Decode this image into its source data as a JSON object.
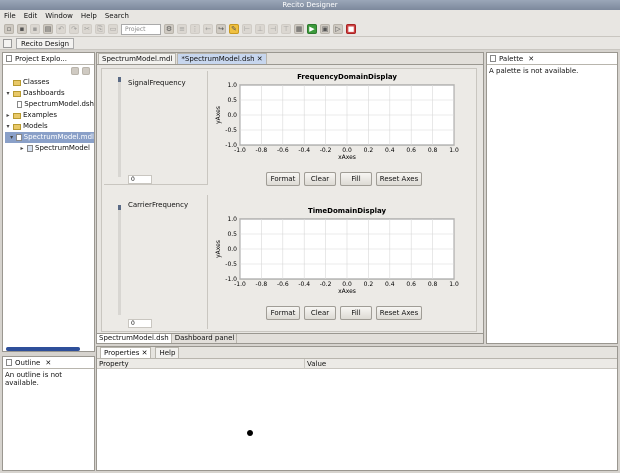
{
  "window": {
    "title": "Recito Designer"
  },
  "menu": [
    "File",
    "Edit",
    "Window",
    "Help",
    "Search"
  ],
  "toolbar": {
    "project_combo": "Project"
  },
  "perspective": {
    "label": "Recito Design"
  },
  "project_explorer": {
    "title": "Project Explo...",
    "items": [
      "Classes",
      "Dashboards",
      "SpectrumModel.dsh",
      "Examples",
      "Models",
      "SpectrumModel.mdl",
      "SpectrumModel"
    ]
  },
  "editor": {
    "tabs": [
      "SpectrumModel.mdl",
      "*SpectrumModel.dsh"
    ],
    "bottom_tabs": [
      "SpectrumModel.dsh",
      "Dashboard panel"
    ]
  },
  "dashboard": [
    {
      "slider_label": "SignalFrequency",
      "slider_value": "0",
      "slider_level": 0.05
    },
    {
      "slider_label": "CarrierFrequency",
      "slider_value": "0",
      "slider_level": 0.05
    }
  ],
  "buttons": [
    "Format",
    "Clear",
    "Fill",
    "Reset Axes"
  ],
  "palette": {
    "title": "Palette",
    "message": "A palette is not available."
  },
  "outline": {
    "title": "Outline",
    "message": "An outline is not available."
  },
  "properties": {
    "tabs": [
      "Properties",
      "Help"
    ],
    "columns": [
      "Property",
      "Value"
    ]
  },
  "chart_data": [
    {
      "type": "line",
      "title": "FrequencyDomainDisplay",
      "xlabel": "xAxes",
      "ylabel": "yAxes",
      "xlim": [
        -1.0,
        1.0
      ],
      "ylim": [
        -1.0,
        1.0
      ],
      "xticks": [
        "-1.0",
        "-0.8",
        "-0.6",
        "-0.4",
        "-0.2",
        "0.0",
        "0.2",
        "0.4",
        "0.6",
        "0.8",
        "1.0"
      ],
      "yticks": [
        "1.0",
        "0.5",
        "0.0",
        "-0.5",
        "-1.0"
      ],
      "grid": true,
      "series": []
    },
    {
      "type": "line",
      "title": "TimeDomainDisplay",
      "xlabel": "xAxes",
      "ylabel": "yAxes",
      "xlim": [
        -1.0,
        1.0
      ],
      "ylim": [
        -1.0,
        1.0
      ],
      "xticks": [
        "-1.0",
        "-0.8",
        "-0.6",
        "-0.4",
        "-0.2",
        "0.0",
        "0.2",
        "0.4",
        "0.6",
        "0.8",
        "1.0"
      ],
      "yticks": [
        "1.0",
        "0.5",
        "0.0",
        "-0.5",
        "-1.0"
      ],
      "grid": true,
      "series": []
    }
  ]
}
